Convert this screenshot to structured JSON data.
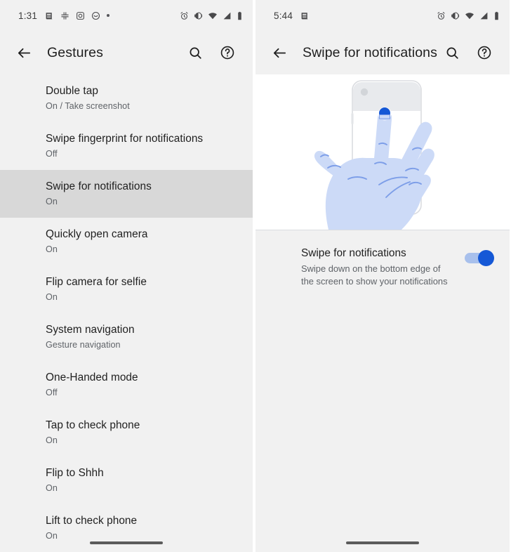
{
  "left": {
    "status": {
      "time": "1:31",
      "left_icons": [
        "news-icon",
        "slack-icon",
        "instagram-icon",
        "smiley-icon",
        "dot-icon"
      ],
      "right_icons": [
        "alarm-icon",
        "vibrate-icon",
        "wifi-icon",
        "signal-icon",
        "battery-icon"
      ]
    },
    "appbar": {
      "back": "back-arrow",
      "title": "Gestures",
      "search": "search",
      "help": "help"
    },
    "items": [
      {
        "title": "Double tap",
        "subtitle": "On / Take screenshot",
        "selected": false
      },
      {
        "title": "Swipe fingerprint for notifications",
        "subtitle": "Off",
        "selected": false
      },
      {
        "title": "Swipe for notifications",
        "subtitle": "On",
        "selected": true
      },
      {
        "title": "Quickly open camera",
        "subtitle": "On",
        "selected": false
      },
      {
        "title": "Flip camera for selfie",
        "subtitle": "On",
        "selected": false
      },
      {
        "title": "System navigation",
        "subtitle": "Gesture navigation",
        "selected": false
      },
      {
        "title": "One-Handed mode",
        "subtitle": "Off",
        "selected": false
      },
      {
        "title": "Tap to check phone",
        "subtitle": "On",
        "selected": false
      },
      {
        "title": "Flip to Shhh",
        "subtitle": "On",
        "selected": false
      },
      {
        "title": "Lift to check phone",
        "subtitle": "On",
        "selected": false
      }
    ]
  },
  "right": {
    "status": {
      "time": "5:44",
      "left_icons": [
        "news-icon"
      ],
      "right_icons": [
        "alarm-icon",
        "vibrate-icon",
        "wifi-icon",
        "signal-icon",
        "battery-icon"
      ]
    },
    "appbar": {
      "back": "back-arrow",
      "title": "Swipe for notifications",
      "search": "search",
      "help": "help"
    },
    "illustration": {
      "name": "swipe-down-hand-phone-illustration",
      "hand_fill": "#ccdaf7",
      "hand_stroke": "#7d9ee8",
      "phone_stroke": "#dadce0",
      "shade_fill": "#e8eaed",
      "touch_dot": "#1558d6"
    },
    "preference": {
      "title": "Swipe for notifications",
      "subtitle": "Swipe down on the bottom edge of the screen to show your notifications",
      "toggle_state": "on",
      "toggle_track_color": "#a8c0ec",
      "toggle_thumb_color": "#1558d6"
    }
  }
}
